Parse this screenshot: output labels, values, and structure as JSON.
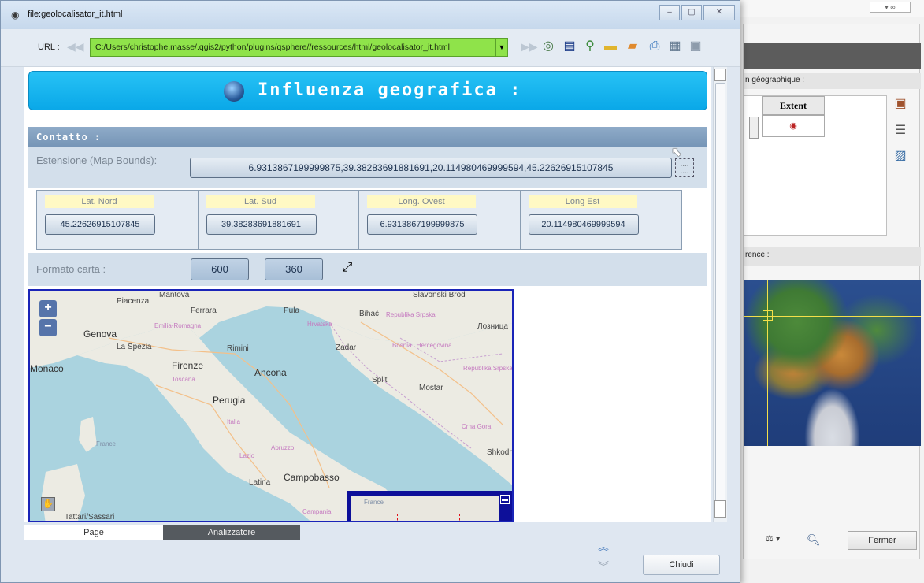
{
  "window": {
    "title": "file:geolocalisator_it.html",
    "controls": [
      "–",
      "▢",
      "✕"
    ]
  },
  "toolbar": {
    "url_label": "URL :",
    "url_value": "C:/Users/christophe.masse/.qgis2/python/plugins/qsphere//ressources/html/geolocalisator_it.html",
    "icons": [
      "back-icon",
      "forward-icon",
      "eye-globe-icon",
      "bookmark-icon",
      "location-icon",
      "folder-icon",
      "folder-view-icon",
      "print-icon",
      "save-as-icon",
      "save-icon"
    ]
  },
  "page": {
    "banner_title": "Influenza geografica :",
    "section_title": "Contatto :",
    "extent": {
      "label": "Estensione (Map Bounds):",
      "value": "6.9313867199999875,39.38283691881691,20.114980469999594,45.22626915107845"
    },
    "coords": [
      {
        "head": "Lat. Nord",
        "value": "45.22626915107845"
      },
      {
        "head": "Lat. Sud",
        "value": "39.38283691881691"
      },
      {
        "head": "Long. Ovest",
        "value": "6.9313867199999875"
      },
      {
        "head": "Long Est",
        "value": "20.114980469999594"
      }
    ],
    "format": {
      "label": "Formato carta :",
      "width": "600",
      "height": "360"
    },
    "map": {
      "labels": {
        "genova": "Genova",
        "monaco": "Monaco",
        "firenze": "Firenze",
        "ancona": "Ancona",
        "perugia": "Perugia",
        "campobasso": "Campobasso",
        "ferrara": "Ferrara",
        "rimini": "Rimini",
        "laspezia": "La Spezia",
        "zadar": "Zadar",
        "bihac": "Bihać",
        "split": "Split",
        "mostar": "Mostar",
        "shkodra": "Shkodra",
        "latina": "Latina",
        "tattari": "Tattari/Sassari",
        "pula": "Pula",
        "piacenza": "Piacenza",
        "mantova": "Mantova",
        "slavonski": "Slavonski Brod",
        "loznica": "Лозница",
        "emilia": "Emilia-Romagna",
        "toscana": "Toscana",
        "italia": "Italia",
        "abruzzo": "Abruzzo",
        "lazio": "Lazio",
        "hrvatska": "Hrvatska",
        "rep_srpska": "Republika Srpska",
        "bosnia": "Bosnia i Hercegovina",
        "rep_srpska2": "Republika Srpska",
        "crna_gora": "Crna Gora",
        "france": "France",
        "campania": "Campania",
        "ov_france": "France"
      },
      "zoom_in": "+",
      "zoom_out": "−"
    }
  },
  "tabs": {
    "page": "Page",
    "analyzer": "Analizzatore"
  },
  "footer": {
    "close_label": "Chiudi"
  },
  "background_app": {
    "geo_label": "n géographique :",
    "extent_header": "Extent",
    "ref_label": "rence :",
    "fermer_label": "Fermer"
  }
}
